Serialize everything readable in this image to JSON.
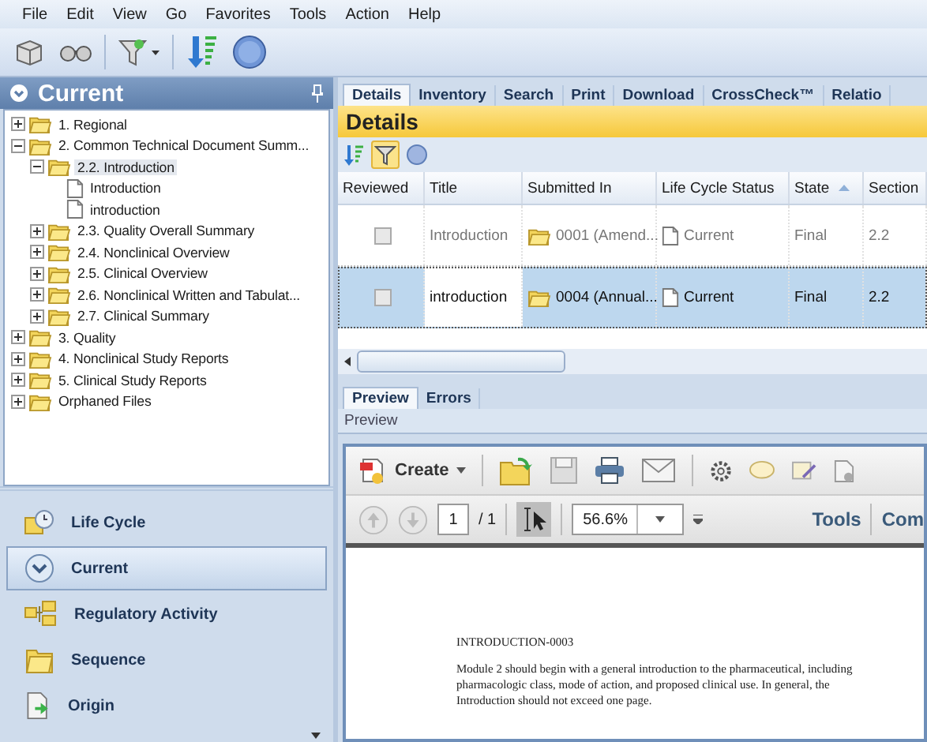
{
  "menu": [
    "File",
    "Edit",
    "View",
    "Go",
    "Favorites",
    "Tools",
    "Action",
    "Help"
  ],
  "left_pane": {
    "title": "Current",
    "tree": [
      {
        "label": "1. Regional",
        "kind": "folder",
        "expanded": false,
        "selected": false
      },
      {
        "label": "2. Common Technical Document Summ...",
        "kind": "folder",
        "expanded": true,
        "selected": false,
        "children": [
          {
            "label": "2.2. Introduction",
            "kind": "folder",
            "expanded": true,
            "selected": true,
            "children": [
              {
                "label": "Introduction",
                "kind": "file",
                "selected": false
              },
              {
                "label": "introduction",
                "kind": "file",
                "selected": false
              }
            ]
          },
          {
            "label": "2.3. Quality Overall Summary",
            "kind": "folder",
            "expanded": false,
            "selected": false
          },
          {
            "label": "2.4. Nonclinical Overview",
            "kind": "folder",
            "expanded": false,
            "selected": false
          },
          {
            "label": "2.5. Clinical Overview",
            "kind": "folder",
            "expanded": false,
            "selected": false
          },
          {
            "label": "2.6. Nonclinical Written and Tabulat...",
            "kind": "folder",
            "expanded": false,
            "selected": false
          },
          {
            "label": "2.7. Clinical Summary",
            "kind": "folder",
            "expanded": false,
            "selected": false
          }
        ]
      },
      {
        "label": "3. Quality",
        "kind": "folder",
        "expanded": false,
        "selected": false
      },
      {
        "label": "4. Nonclinical Study Reports",
        "kind": "folder",
        "expanded": false,
        "selected": false
      },
      {
        "label": "5. Clinical Study Reports",
        "kind": "folder",
        "expanded": false,
        "selected": false
      },
      {
        "label": "Orphaned Files",
        "kind": "folder",
        "expanded": false,
        "selected": false
      }
    ]
  },
  "nav": [
    {
      "label": "Life Cycle",
      "kind": "clock",
      "selected": false
    },
    {
      "label": "Current",
      "kind": "chevron",
      "selected": true
    },
    {
      "label": "Regulatory Activity",
      "kind": "folders",
      "selected": false
    },
    {
      "label": "Sequence",
      "kind": "folder",
      "selected": false
    },
    {
      "label": "Origin",
      "kind": "document",
      "selected": false
    }
  ],
  "tabs": [
    {
      "label": "Details",
      "selected": true
    },
    {
      "label": "Inventory",
      "selected": false
    },
    {
      "label": "Search",
      "selected": false
    },
    {
      "label": "Print",
      "selected": false
    },
    {
      "label": "Download",
      "selected": false
    },
    {
      "label": "CrossCheck™",
      "selected": false
    },
    {
      "label": "Relatio",
      "selected": false
    }
  ],
  "details": {
    "title": "Details",
    "columns": [
      {
        "label": "Reviewed",
        "sorted": false
      },
      {
        "label": "Title",
        "sorted": false
      },
      {
        "label": "Submitted In",
        "sorted": false
      },
      {
        "label": "Life Cycle Status",
        "sorted": false
      },
      {
        "label": "State",
        "sorted": true
      },
      {
        "label": "Section",
        "sorted": false
      }
    ],
    "rows": [
      {
        "reviewed": false,
        "title": "Introduction",
        "submitted_in": "0001 (Amend...",
        "life_cycle_status": "Current",
        "state": "Final",
        "section": "2.2",
        "selected": false
      },
      {
        "reviewed": false,
        "title": "introduction",
        "submitted_in": "0004 (Annual...",
        "life_cycle_status": "Current",
        "state": "Final",
        "section": "2.2",
        "selected": true
      }
    ]
  },
  "preview_tabs": [
    {
      "label": "Preview",
      "selected": true
    },
    {
      "label": "Errors",
      "selected": false
    }
  ],
  "preview_label": "Preview",
  "pdf": {
    "create": "Create",
    "page": "1",
    "page_total": "/ 1",
    "zoom": "56.6%",
    "tools": "Tools",
    "comment": "Com",
    "heading": "INTRODUCTION-0003",
    "paragraph_lines": [
      "Module 2 should begin with a general introduction to the pharmaceutical, including",
      "pharmacologic class, mode of action, and proposed clinical use.  In general, the",
      "Introduction should not exceed one page."
    ]
  }
}
